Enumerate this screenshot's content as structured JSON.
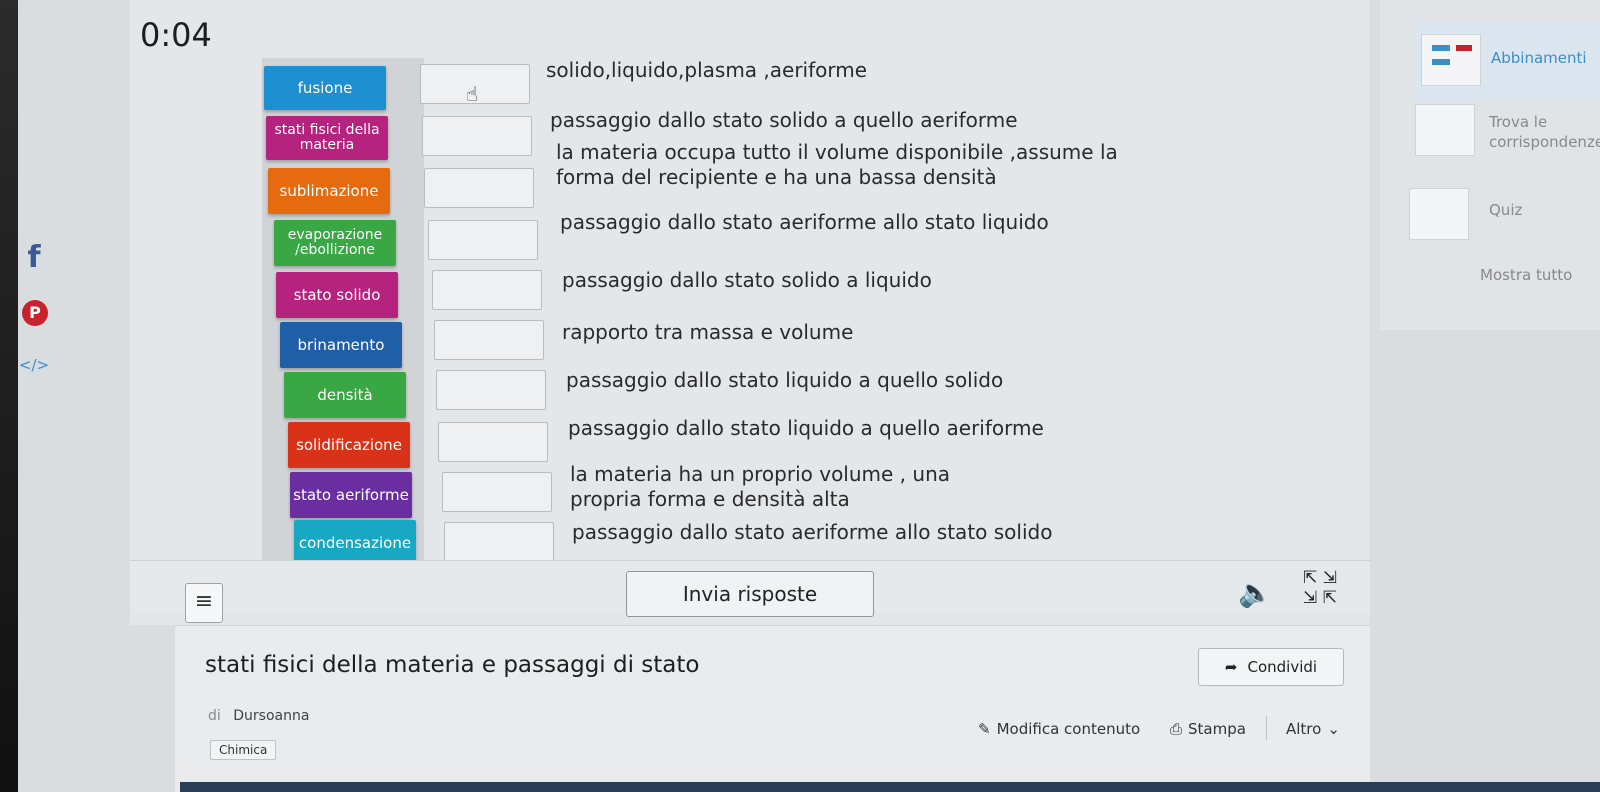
{
  "timer": "0:04",
  "tiles": [
    {
      "label": "fusione",
      "color": "#1e8fd0"
    },
    {
      "label": "stati fisici della materia",
      "color": "#b5237f"
    },
    {
      "label": "sublimazione",
      "color": "#e66a0e"
    },
    {
      "label": "evaporazione /ebollizione",
      "color": "#3aa745"
    },
    {
      "label": "stato solido",
      "color": "#b5237f"
    },
    {
      "label": "brinamento",
      "color": "#1f5fa8"
    },
    {
      "label": "densità",
      "color": "#3aa745"
    },
    {
      "label": "solidificazione",
      "color": "#d93219"
    },
    {
      "label": "stato aeriforme",
      "color": "#6a2ea0"
    },
    {
      "label": "condensazione",
      "color": "#17a9c4"
    }
  ],
  "descriptions": [
    "solido,liquido,plasma ,aeriforme",
    "passaggio dallo stato solido a quello aeriforme",
    "la materia occupa tutto il volume disponibile ,assume la forma del recipiente e ha una bassa densità",
    "passaggio dallo stato aeriforme allo stato liquido",
    "passaggio dallo stato solido a liquido",
    "rapporto tra massa e volume",
    "passaggio dallo stato liquido a quello solido",
    "passaggio dallo stato liquido a quello aeriforme",
    "la materia ha un proprio volume , una propria forma e densità alta",
    "passaggio dallo stato aeriforme allo stato solido"
  ],
  "sidebar": {
    "items": [
      {
        "label": "Abbinamenti",
        "active": true
      },
      {
        "label": "Trova le corrispondenze",
        "active": false
      },
      {
        "label": "Quiz",
        "active": false
      }
    ],
    "show_all": "Mostra tutto"
  },
  "controls": {
    "submit_label": "Invia risposte",
    "menu_icon": "hamburger-icon",
    "speaker_icon": "speaker-icon",
    "fullscreen_icon": "fullscreen-icon"
  },
  "activity": {
    "title": "stati fisici della materia e passaggi di stato",
    "by_prefix": "di",
    "author": "Dursoanna",
    "tag": "Chimica",
    "share_label": "Condividi",
    "edit_label": "Modifica contenuto",
    "print_label": "Stampa",
    "more_label": "Altro"
  },
  "social": [
    "facebook-icon",
    "pinterest-icon",
    "embed-icon"
  ]
}
